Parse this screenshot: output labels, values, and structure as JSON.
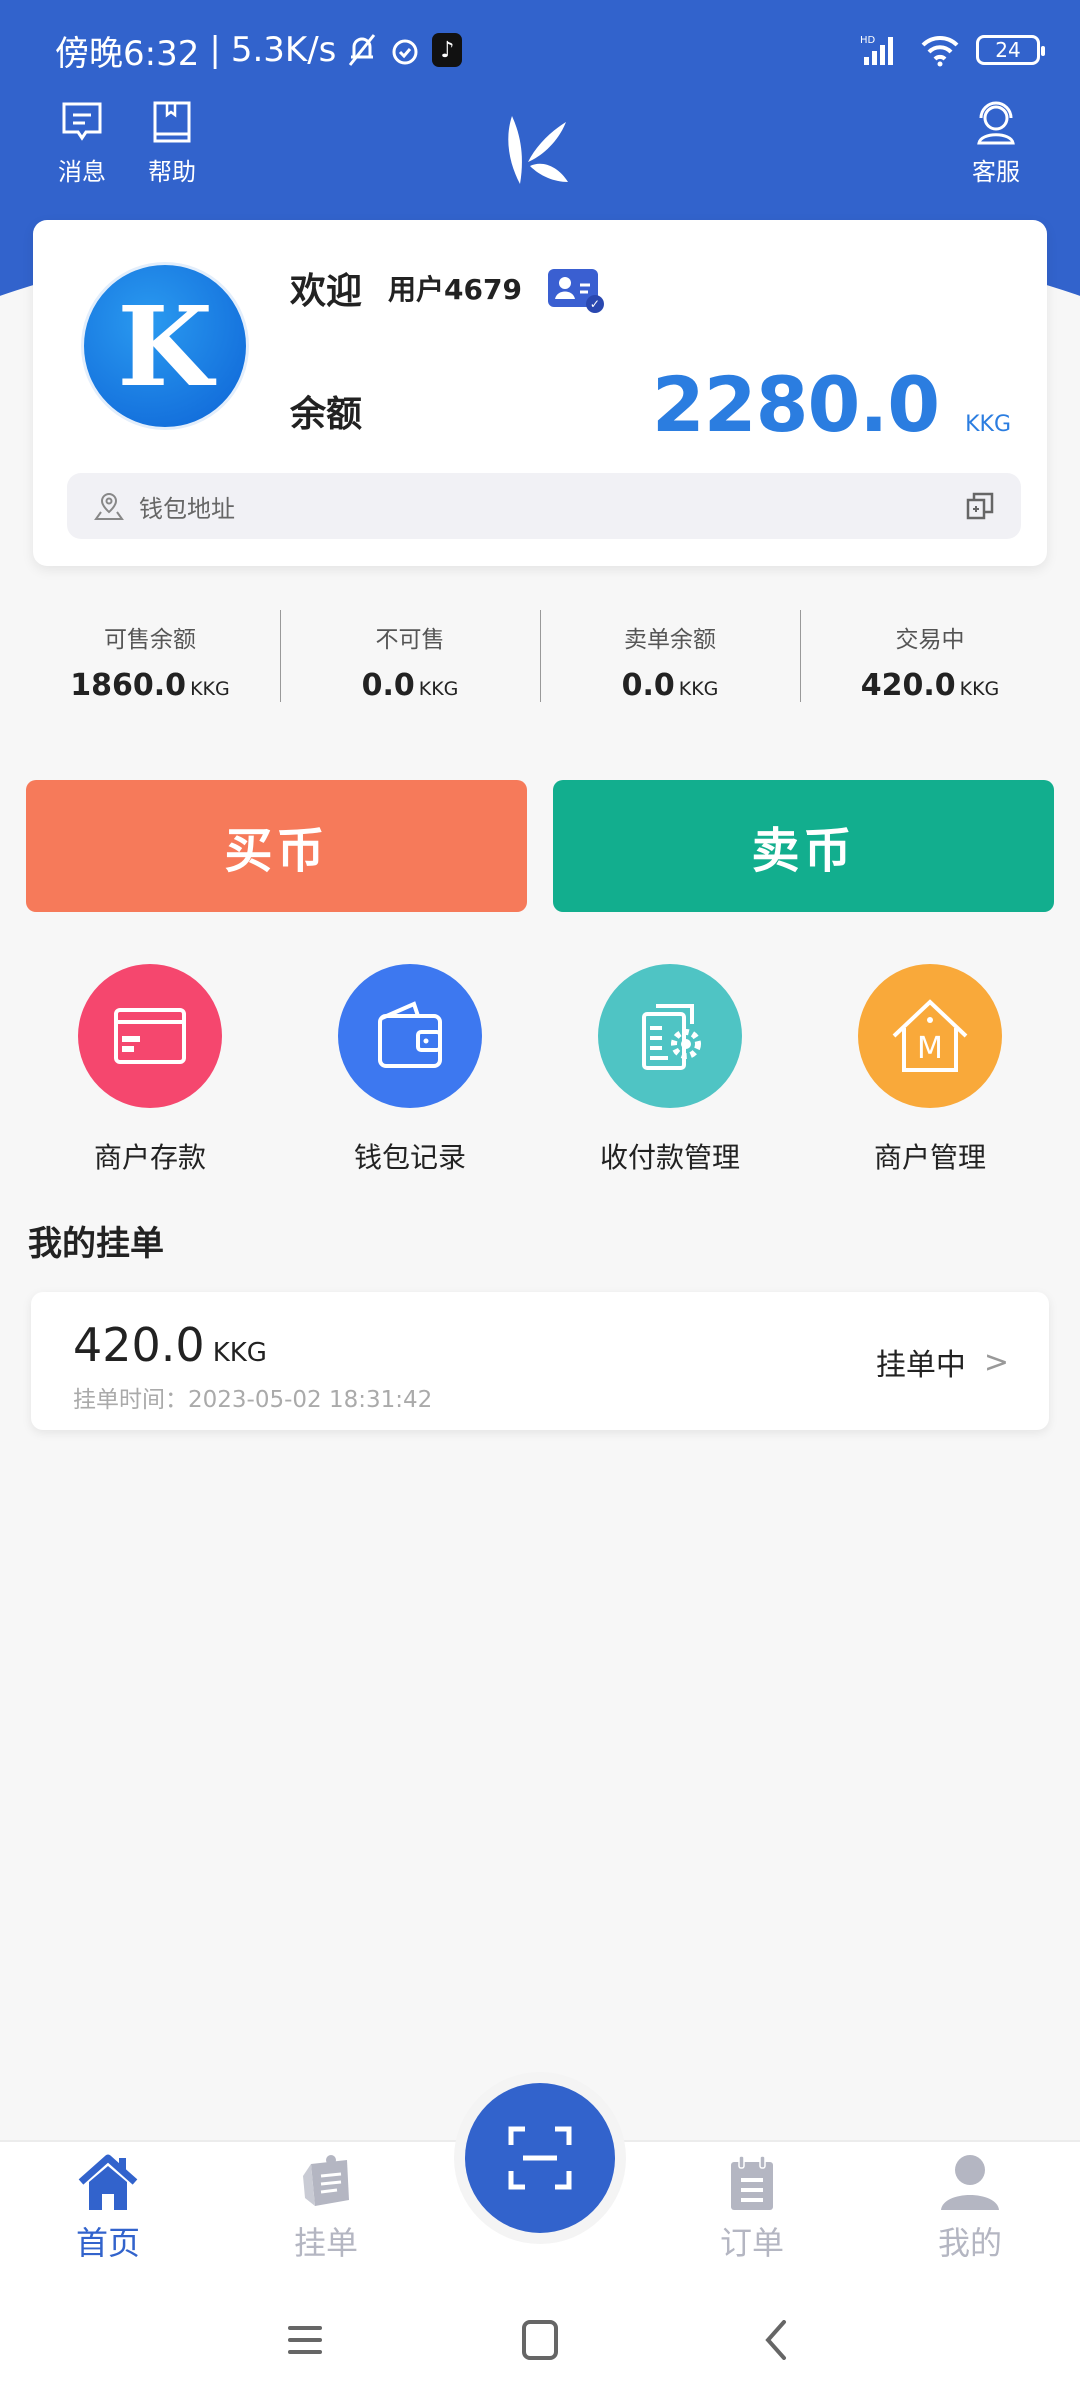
{
  "status_bar": {
    "time": "傍晚6:32",
    "net_speed": "5.3K/s",
    "battery": "24",
    "network": "HD"
  },
  "top_nav": {
    "messages_label": "消息",
    "help_label": "帮助",
    "service_label": "客服"
  },
  "profile": {
    "welcome": "欢迎",
    "username": "用户4679",
    "avatar_letter": "K",
    "balance_label": "余额",
    "balance_value": "2280.0",
    "balance_unit": "KKG",
    "wallet_address_label": "钱包地址"
  },
  "stats": [
    {
      "label": "可售余额",
      "value": "1860.0",
      "unit": "KKG"
    },
    {
      "label": "不可售",
      "value": "0.0",
      "unit": "KKG"
    },
    {
      "label": "卖单余额",
      "value": "0.0",
      "unit": "KKG"
    },
    {
      "label": "交易中",
      "value": "420.0",
      "unit": "KKG"
    }
  ],
  "trade": {
    "buy_label": "买币",
    "sell_label": "卖币",
    "buy_color": "#f67a5a",
    "sell_color": "#12ae8e"
  },
  "actions": [
    {
      "label": "商户存款",
      "icon": "card-icon",
      "color": "#f5476e"
    },
    {
      "label": "钱包记录",
      "icon": "wallet-icon",
      "color": "#3d78f0"
    },
    {
      "label": "收付款管理",
      "icon": "document-gear-icon",
      "color": "#4fc4c4"
    },
    {
      "label": "商户管理",
      "icon": "house-m-icon",
      "color": "#f9a93a"
    }
  ],
  "my_orders": {
    "title": "我的挂单",
    "items": [
      {
        "amount": "420.0",
        "unit": "KKG",
        "time": "挂单时间：2023-05-02 18:31:42",
        "status": "挂单中"
      }
    ]
  },
  "tabbar": {
    "items": [
      {
        "label": "首页",
        "active": true
      },
      {
        "label": "挂单",
        "active": false
      },
      {
        "label": "订单",
        "active": false
      },
      {
        "label": "我的",
        "active": false
      }
    ],
    "accent": "#3263cc"
  }
}
